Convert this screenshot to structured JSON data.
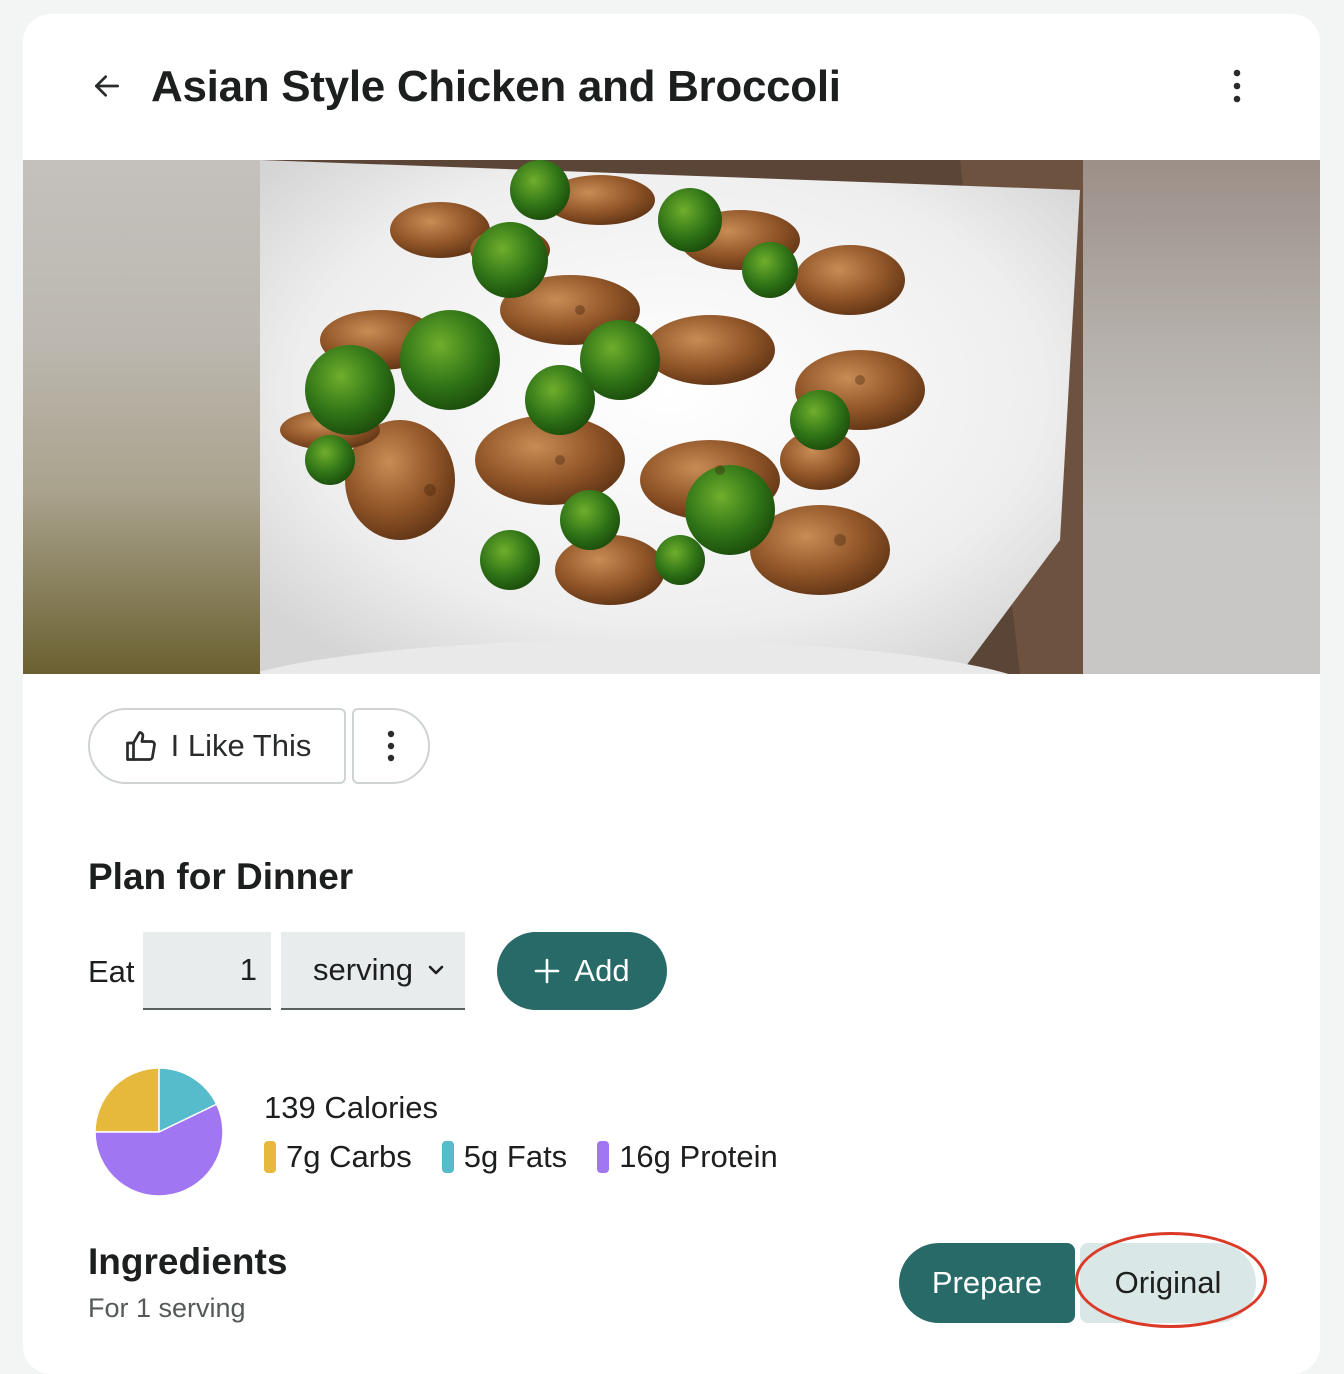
{
  "header": {
    "title": "Asian Style Chicken and Broccoli",
    "back_icon": "arrow-left-icon",
    "menu_icon": "more-vertical-icon"
  },
  "actions": {
    "like_label": "I Like This",
    "like_icon": "thumbs-up-icon",
    "more_icon": "more-vertical-icon"
  },
  "plan": {
    "heading": "Plan for Dinner",
    "eat_label": "Eat",
    "quantity": "1",
    "unit": "serving",
    "add_label": "Add"
  },
  "nutrition": {
    "calories": "139 Calories",
    "macros": [
      {
        "label": "7g Carbs",
        "color": "#e6b83c"
      },
      {
        "label": "5g Fats",
        "color": "#56bccb"
      },
      {
        "label": "16g Protein",
        "color": "#a176f2"
      }
    ]
  },
  "chart_data": {
    "type": "pie",
    "categories": [
      "Carbs",
      "Fats",
      "Protein"
    ],
    "values": [
      7,
      5,
      16
    ],
    "colors": [
      "#e6b83c",
      "#56bccb",
      "#a176f2"
    ]
  },
  "ingredients": {
    "heading": "Ingredients",
    "subtitle": "For 1 serving",
    "prepare_label": "Prepare",
    "original_label": "Original"
  },
  "colors": {
    "primary": "#286a67",
    "original_bg": "#d9e7e6",
    "highlight": "#db3a27"
  }
}
